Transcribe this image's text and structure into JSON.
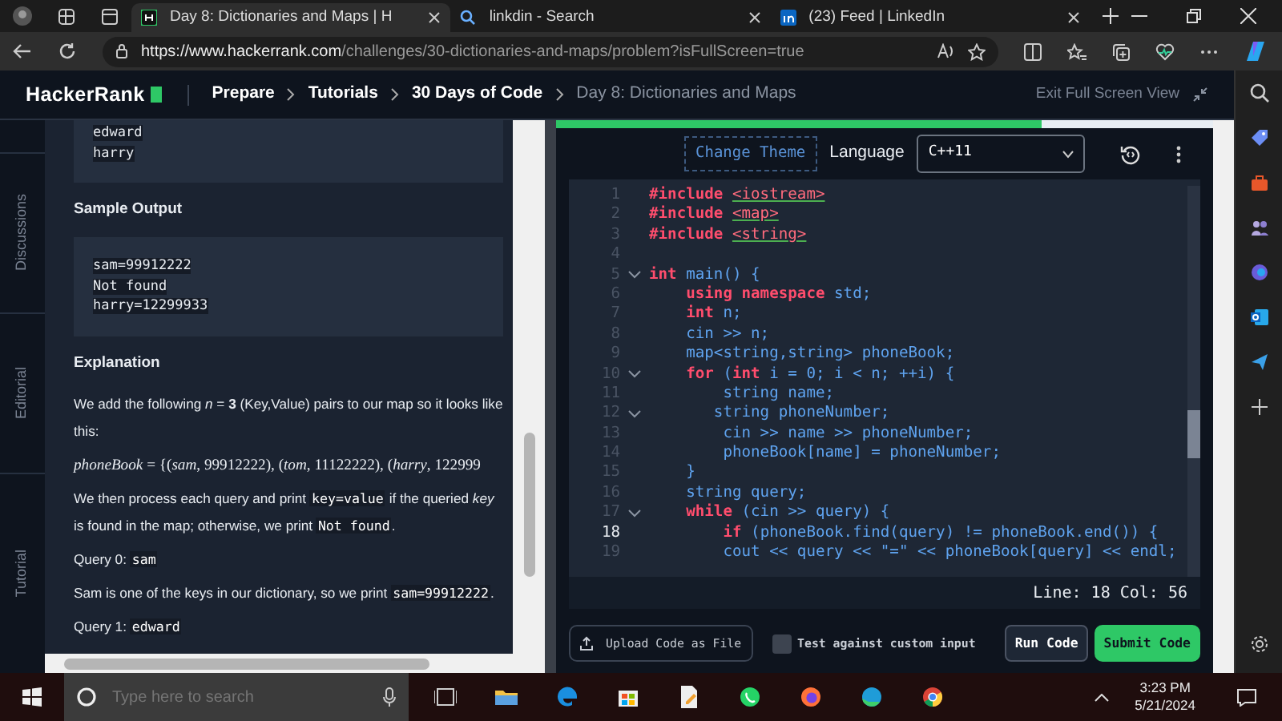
{
  "browser": {
    "tabs": [
      {
        "title": "Day 8: Dictionaries and Maps | H",
        "kind": "hackerrank",
        "selected": true
      },
      {
        "title": "linkdin - Search",
        "kind": "search",
        "selected": false
      },
      {
        "title": "(23) Feed | LinkedIn",
        "kind": "linkedin",
        "selected": false
      }
    ],
    "url_host": "https://www.hackerrank.com",
    "url_path": "/challenges/30-dictionaries-and-maps/problem?isFullScreen=true"
  },
  "header": {
    "logo": "HackerRank",
    "breadcrumbs": [
      {
        "label": "Prepare",
        "current": false
      },
      {
        "label": "Tutorials",
        "current": false
      },
      {
        "label": "30 Days of Code",
        "current": false
      },
      {
        "label": "Day 8: Dictionaries and Maps",
        "current": true
      }
    ],
    "exit": "Exit Full Screen View"
  },
  "side_tabs": [
    "Discussions",
    "Editorial",
    "Tutorial"
  ],
  "problem": [
    {
      "kind": "code",
      "lines": [
        "edward",
        "harry"
      ]
    },
    {
      "kind": "heading",
      "text": "Sample Output"
    },
    {
      "kind": "code",
      "lines": [
        "sam=99912222",
        "Not found",
        "harry=12299933"
      ]
    },
    {
      "kind": "heading",
      "text": "Explanation"
    },
    {
      "kind": "para",
      "parts": [
        {
          "kind": "text",
          "text": "We add the following *n* = **3** (Key,Value) pairs to our map so it looks like this:"
        }
      ]
    },
    {
      "kind": "formula",
      "parts": [
        {
          "kind": "text",
          "text": "*phoneBook* = {(*sam*, 99912222), (*tom*, 11122222), (*harry*, 122999"
        }
      ]
    },
    {
      "kind": "para",
      "parts": [
        {
          "kind": "text",
          "text": "We then process each query and print "
        },
        {
          "kind": "code",
          "text": "key=value"
        },
        {
          "kind": "text",
          "text": " if the queried *key* is found in the map; otherwise, we print "
        },
        {
          "kind": "code",
          "text": "Not found"
        },
        {
          "kind": "text",
          "text": "."
        }
      ]
    },
    {
      "kind": "para",
      "parts": [
        {
          "kind": "text",
          "text": "Query 0: "
        },
        {
          "kind": "code",
          "text": "sam"
        }
      ]
    },
    {
      "kind": "para",
      "parts": [
        {
          "kind": "text",
          "text": "Sam is one of the keys in our dictionary, so we print "
        },
        {
          "kind": "code",
          "text": "sam=99912222"
        },
        {
          "kind": "text",
          "text": "."
        }
      ]
    },
    {
      "kind": "para",
      "parts": [
        {
          "kind": "text",
          "text": "Query 1: "
        },
        {
          "kind": "code",
          "text": "edward"
        }
      ]
    }
  ],
  "editor": {
    "progress": {
      "level": 0.74
    },
    "change_theme": "Change Theme",
    "language_label": "Language",
    "language": "C++11",
    "lines": [
      {
        "number": "1",
        "fold": false,
        "current": false,
        "tokens": [
          {
            "kind": "keyword",
            "text": "#include "
          },
          {
            "kind": "include",
            "text": "<iostream>"
          }
        ]
      },
      {
        "number": "2",
        "fold": false,
        "current": false,
        "tokens": [
          {
            "kind": "keyword",
            "text": "#include "
          },
          {
            "kind": "include",
            "text": "<map>"
          }
        ]
      },
      {
        "number": "3",
        "fold": false,
        "current": false,
        "tokens": [
          {
            "kind": "keyword",
            "text": "#include "
          },
          {
            "kind": "include",
            "text": "<string>"
          }
        ]
      },
      {
        "number": "4",
        "fold": false,
        "current": false
      },
      {
        "number": "5",
        "fold": true,
        "current": false,
        "tokens": [
          {
            "kind": "keyword",
            "text": "int"
          },
          {
            "kind": "plain",
            "text": " main() {"
          }
        ]
      },
      {
        "number": "6",
        "fold": false,
        "current": false,
        "tokens": [
          {
            "kind": "keyword",
            "text": "    using namespace"
          },
          {
            "kind": "plain",
            "text": " std;"
          }
        ]
      },
      {
        "number": "7",
        "fold": false,
        "current": false,
        "tokens": [
          {
            "kind": "keyword",
            "text": "    int"
          },
          {
            "kind": "plain",
            "text": " n;"
          }
        ]
      },
      {
        "number": "8",
        "fold": false,
        "current": false,
        "tokens": [
          {
            "kind": "plain",
            "text": "    cin >> n;"
          }
        ]
      },
      {
        "number": "9",
        "fold": false,
        "current": false,
        "tokens": [
          {
            "kind": "plain",
            "text": "    map<string,string> phoneBook;"
          }
        ]
      },
      {
        "number": "10",
        "fold": true,
        "current": false,
        "tokens": [
          {
            "kind": "keyword",
            "text": "    for"
          },
          {
            "kind": "plain",
            "text": " ("
          },
          {
            "kind": "keyword",
            "text": "int"
          },
          {
            "kind": "plain",
            "text": " i = 0; i < n; ++i) {"
          }
        ]
      },
      {
        "number": "11",
        "fold": false,
        "current": false,
        "tokens": [
          {
            "kind": "plain",
            "text": "        string name;"
          }
        ]
      },
      {
        "number": "12",
        "fold": true,
        "current": false,
        "tokens": [
          {
            "kind": "plain",
            "text": "       string phoneNumber;"
          }
        ]
      },
      {
        "number": "13",
        "fold": false,
        "current": false,
        "tokens": [
          {
            "kind": "plain",
            "text": "        cin >> name >> phoneNumber;"
          }
        ]
      },
      {
        "number": "14",
        "fold": false,
        "current": false,
        "tokens": [
          {
            "kind": "plain",
            "text": "        phoneBook[name] = phoneNumber;"
          }
        ]
      },
      {
        "number": "15",
        "fold": false,
        "current": false,
        "tokens": [
          {
            "kind": "plain",
            "text": "    }"
          }
        ]
      },
      {
        "number": "16",
        "fold": false,
        "current": false,
        "tokens": [
          {
            "kind": "plain",
            "text": "    string query;"
          }
        ]
      },
      {
        "number": "17",
        "fold": true,
        "current": false,
        "tokens": [
          {
            "kind": "keyword",
            "text": "    while"
          },
          {
            "kind": "plain",
            "text": " (cin >> query) {"
          }
        ]
      },
      {
        "number": "18",
        "fold": false,
        "current": true,
        "tokens": [
          {
            "kind": "keyword",
            "text": "        if"
          },
          {
            "kind": "plain",
            "text": " (phoneBook.find(query) != phoneBook.end()) {"
          }
        ]
      },
      {
        "number": "19",
        "fold": false,
        "current": false,
        "tokens": [
          {
            "kind": "plain",
            "text": "        cout << query << \"=\" << phoneBook[query] << endl;"
          }
        ]
      }
    ],
    "cursor": "Line: 18 Col: 56",
    "upload": "Upload Code as File",
    "custom_input": {
      "label": "Test against custom input",
      "checked": false
    },
    "run": "Run Code",
    "submit": "Submit Code"
  },
  "taskbar": {
    "search_placeholder": "Type here to search",
    "time": "3:23 PM",
    "date": "5/21/2024"
  }
}
